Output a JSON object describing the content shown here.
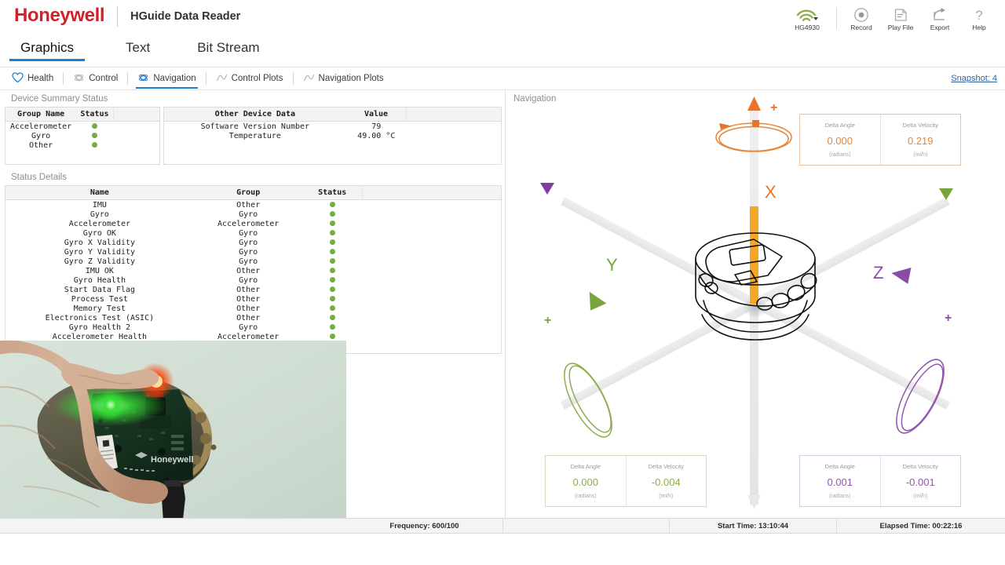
{
  "titlebar": {
    "brand": "Honeywell",
    "app_title": "HGuide Data Reader",
    "device_label": "HG4930",
    "tools": [
      {
        "name": "record",
        "label": "Record"
      },
      {
        "name": "play-file",
        "label": "Play File"
      },
      {
        "name": "export",
        "label": "Export"
      },
      {
        "name": "help",
        "label": "Help"
      }
    ]
  },
  "tabs": [
    {
      "label": "Graphics",
      "active": true
    },
    {
      "label": "Text",
      "active": false
    },
    {
      "label": "Bit Stream",
      "active": false
    }
  ],
  "subtoolbar": {
    "items": [
      {
        "label": "Health",
        "icon": "heart-icon",
        "active": false
      },
      {
        "label": "Control",
        "icon": "cube-icon",
        "active": false
      },
      {
        "label": "Navigation",
        "icon": "cube-icon",
        "active": true
      },
      {
        "label": "Control Plots",
        "icon": "chart-line-icon",
        "active": false
      },
      {
        "label": "Navigation Plots",
        "icon": "chart-line-icon",
        "active": false
      }
    ],
    "snapshot_label": "Snapshot: 4"
  },
  "device_summary": {
    "section_title": "Device Summary Status",
    "group_table": {
      "headers": [
        "Group Name",
        "Status",
        ""
      ],
      "rows": [
        {
          "name": "Accelerometer",
          "status": "ok"
        },
        {
          "name": "Gyro",
          "status": "ok"
        },
        {
          "name": "Other",
          "status": "ok"
        }
      ]
    },
    "other_table": {
      "headers": [
        "Other Device Data",
        "Value",
        ""
      ],
      "rows": [
        {
          "name": "Software Version Number",
          "value": "79"
        },
        {
          "name": "Temperature",
          "value": "49.00 °C"
        }
      ]
    }
  },
  "status_details": {
    "section_title": "Status Details",
    "headers": [
      "Name",
      "Group",
      "Status",
      ""
    ],
    "rows": [
      {
        "name": "IMU",
        "group": "Other",
        "status": "ok"
      },
      {
        "name": "Gyro",
        "group": "Gyro",
        "status": "ok"
      },
      {
        "name": "Accelerometer",
        "group": "Accelerometer",
        "status": "ok"
      },
      {
        "name": "Gyro OK",
        "group": "Gyro",
        "status": "ok"
      },
      {
        "name": "Gyro X Validity",
        "group": "Gyro",
        "status": "ok"
      },
      {
        "name": "Gyro Y Validity",
        "group": "Gyro",
        "status": "ok"
      },
      {
        "name": "Gyro Z Validity",
        "group": "Gyro",
        "status": "ok"
      },
      {
        "name": "IMU OK",
        "group": "Other",
        "status": "ok"
      },
      {
        "name": "Gyro Health",
        "group": "Gyro",
        "status": "ok"
      },
      {
        "name": "Start Data Flag",
        "group": "Other",
        "status": "ok"
      },
      {
        "name": "Process Test",
        "group": "Other",
        "status": "ok"
      },
      {
        "name": "Memory Test",
        "group": "Other",
        "status": "ok"
      },
      {
        "name": "Electronics Test (ASIC)",
        "group": "Other",
        "status": "ok"
      },
      {
        "name": "Gyro Health 2",
        "group": "Gyro",
        "status": "ok"
      },
      {
        "name": "Accelerometer Health",
        "group": "Accelerometer",
        "status": "ok"
      }
    ]
  },
  "navigation": {
    "section_title": "Navigation",
    "axes": [
      {
        "axis": "X",
        "color": "#e8873b",
        "sign": "+",
        "delta_angle_label": "Delta Angle",
        "delta_angle_value": "0.000",
        "delta_angle_units": "(radians)",
        "delta_velocity_label": "Delta Velocity",
        "delta_velocity_value": "0.219",
        "delta_velocity_units": "(mi/h)"
      },
      {
        "axis": "Y",
        "color": "#8fae52",
        "sign": "+",
        "delta_angle_label": "Delta Angle",
        "delta_angle_value": "0.000",
        "delta_angle_units": "(radians)",
        "delta_velocity_label": "Delta Velocity",
        "delta_velocity_value": "-0.004",
        "delta_velocity_units": "(mi/h)"
      },
      {
        "axis": "Z",
        "color": "#9257aa",
        "sign": "+",
        "delta_angle_label": "Delta Angle",
        "delta_angle_value": "0.001",
        "delta_angle_units": "(radians)",
        "delta_velocity_label": "Delta Velocity",
        "delta_velocity_value": "-0.001",
        "delta_velocity_units": "(mi/h)"
      }
    ]
  },
  "statusbar": {
    "frequency": "Frequency: 600/100",
    "blank": "",
    "start_time": "Start Time: 13:10:44",
    "elapsed_time": "Elapsed Time: 00:22:16"
  },
  "colors": {
    "brand_red": "#d0222a",
    "accent_blue": "#1b7fd4",
    "status_green": "#76b043",
    "axis_x": "#e8873b",
    "axis_x_bar": "#f5a623",
    "axis_y": "#8fae52",
    "axis_z": "#9257aa"
  }
}
